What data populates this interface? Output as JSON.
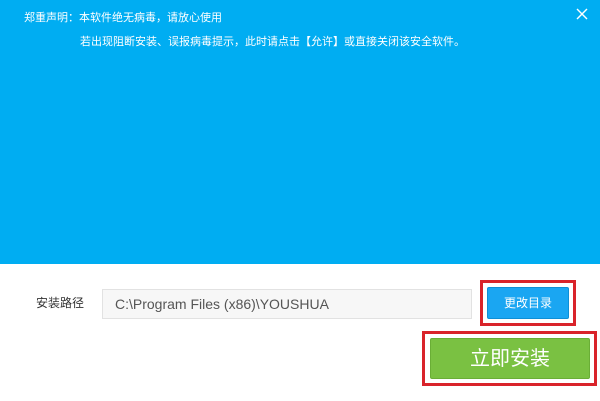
{
  "notice": {
    "line1": "郑重声明：本软件绝无病毒，请放心使用",
    "line2": "若出现阻断安装、误报病毒提示，此时请点击【允许】或直接关闭该安全软件。"
  },
  "icons": {
    "close": "close-icon"
  },
  "install_path": {
    "label": "安装路径",
    "value": "C:\\Program Files (x86)\\YOUSHUA"
  },
  "buttons": {
    "change_dir": "更改目录",
    "install_now": "立即安装"
  },
  "colors": {
    "banner": "#00adf2",
    "change_dir_button": "#1aa6f2",
    "install_button": "#7ac142",
    "highlight": "#d9232a"
  }
}
